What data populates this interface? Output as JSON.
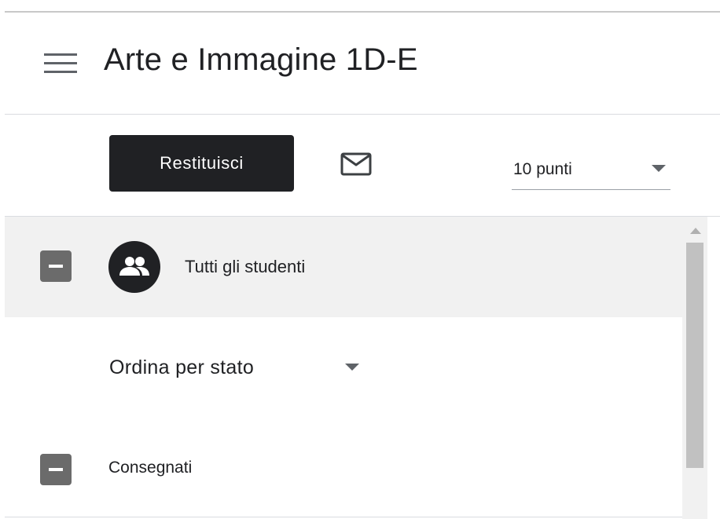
{
  "header": {
    "menu_icon": "hamburger-menu-icon",
    "class_title": "Arte e Immagine 1D-E"
  },
  "toolbar": {
    "return_label": "Restituisci",
    "mail_icon": "mail-envelope-icon",
    "points_value": "10 punti"
  },
  "students": {
    "all_label": "Tutti gli studenti",
    "group_icon": "people-group-icon",
    "sort_label": "Ordina per stato",
    "sections": [
      {
        "label": "Consegnati"
      }
    ]
  },
  "colors": {
    "primary_button": "#202124",
    "selected_row": "#f1f1f1",
    "checkbox": "#6b6b6b",
    "divider": "#dadce0"
  }
}
